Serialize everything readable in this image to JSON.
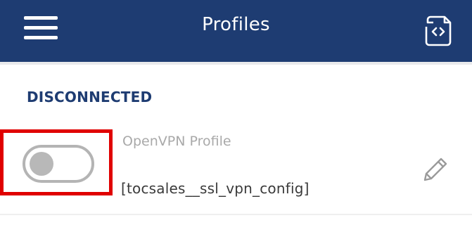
{
  "header": {
    "title": "Profiles",
    "background_color": "#1e3c72",
    "menu_icon": "hamburger-menu-icon",
    "import_icon": "import-file-icon"
  },
  "section": {
    "status_label": "DISCONNECTED",
    "status_color": "#1e3c72"
  },
  "profile": {
    "type_label": "OpenVPN Profile",
    "name": "[tocsales__ssl_vpn_config]",
    "toggle_state": "off",
    "edit_icon": "pencil-icon"
  },
  "highlight": {
    "color": "#e00000"
  }
}
